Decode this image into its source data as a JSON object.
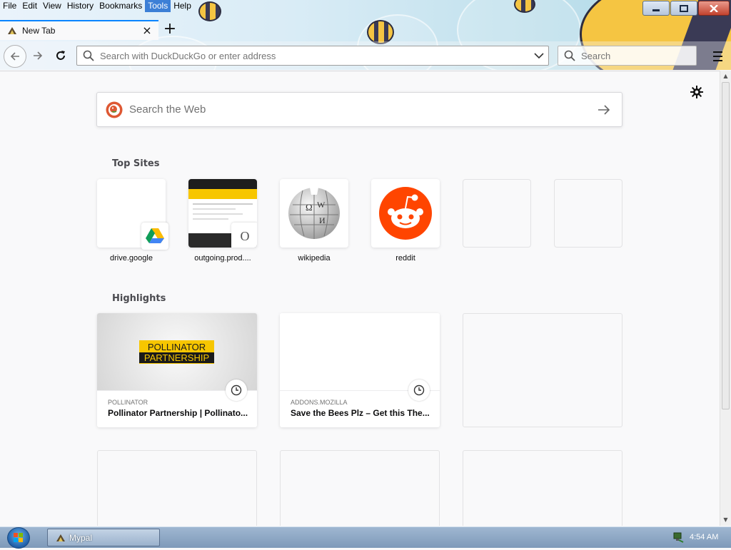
{
  "menu": {
    "items": [
      "File",
      "Edit",
      "View",
      "History",
      "Bookmarks",
      "Tools",
      "Help"
    ],
    "active": "Tools"
  },
  "tab": {
    "title": "New Tab",
    "close_icon": "close-icon",
    "new_tab_icon": "plus-icon"
  },
  "navbar": {
    "url_placeholder": "Search with DuckDuckGo or enter address",
    "search_placeholder": "Search"
  },
  "content": {
    "web_search_placeholder": "Search the Web",
    "topsites_title": "Top Sites",
    "highlights_title": "Highlights",
    "topsites": [
      {
        "label": "drive.google"
      },
      {
        "label": "outgoing.prod...."
      },
      {
        "label": "wikipedia"
      },
      {
        "label": "reddit"
      }
    ],
    "highlights": [
      {
        "source": "POLLINATOR",
        "title": "Pollinator Partnership | Pollinato...",
        "logo_lines": [
          "POLLINATOR",
          "PARTNERSHIP"
        ]
      },
      {
        "source": "ADDONS.MOZILLA",
        "title": "Save the Bees Plz – Get this The..."
      }
    ]
  },
  "taskbar": {
    "app_label": "Mypal",
    "clock": "4:54 AM"
  },
  "colors": {
    "accent": "#0a84ff",
    "reddit": "#ff4500",
    "ddg": "#de5833",
    "pollinator_yellow": "#f7c600"
  }
}
